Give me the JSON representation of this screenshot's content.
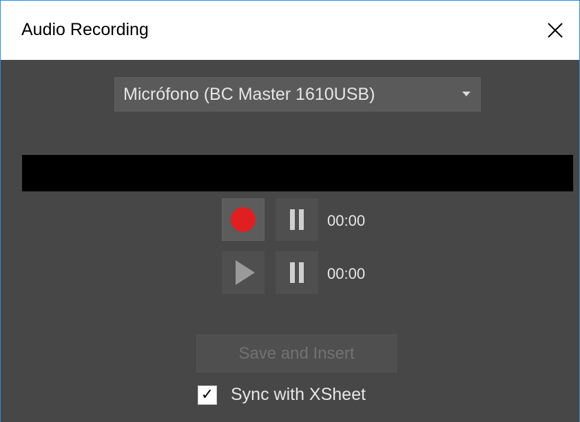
{
  "window": {
    "title": "Audio Recording",
    "close_icon": "close-icon"
  },
  "device": {
    "selected": "Micrófono (BC  Master  1610USB)",
    "caret_icon": "chevron-down-icon"
  },
  "record": {
    "record_icon": "record-icon",
    "pause_icon": "pause-icon",
    "time": "00:00"
  },
  "playback": {
    "play_icon": "play-icon",
    "pause_icon": "pause-icon",
    "time": "00:00"
  },
  "actions": {
    "save_insert_label": "Save and Insert",
    "save_insert_enabled": false
  },
  "sync": {
    "label": "Sync with XSheet",
    "checked": true,
    "check_glyph": "✓"
  },
  "colors": {
    "window_border": "#1f8fe0",
    "panel_bg": "#474747",
    "record_red": "#e02020",
    "level_meter_bg": "#000000"
  }
}
